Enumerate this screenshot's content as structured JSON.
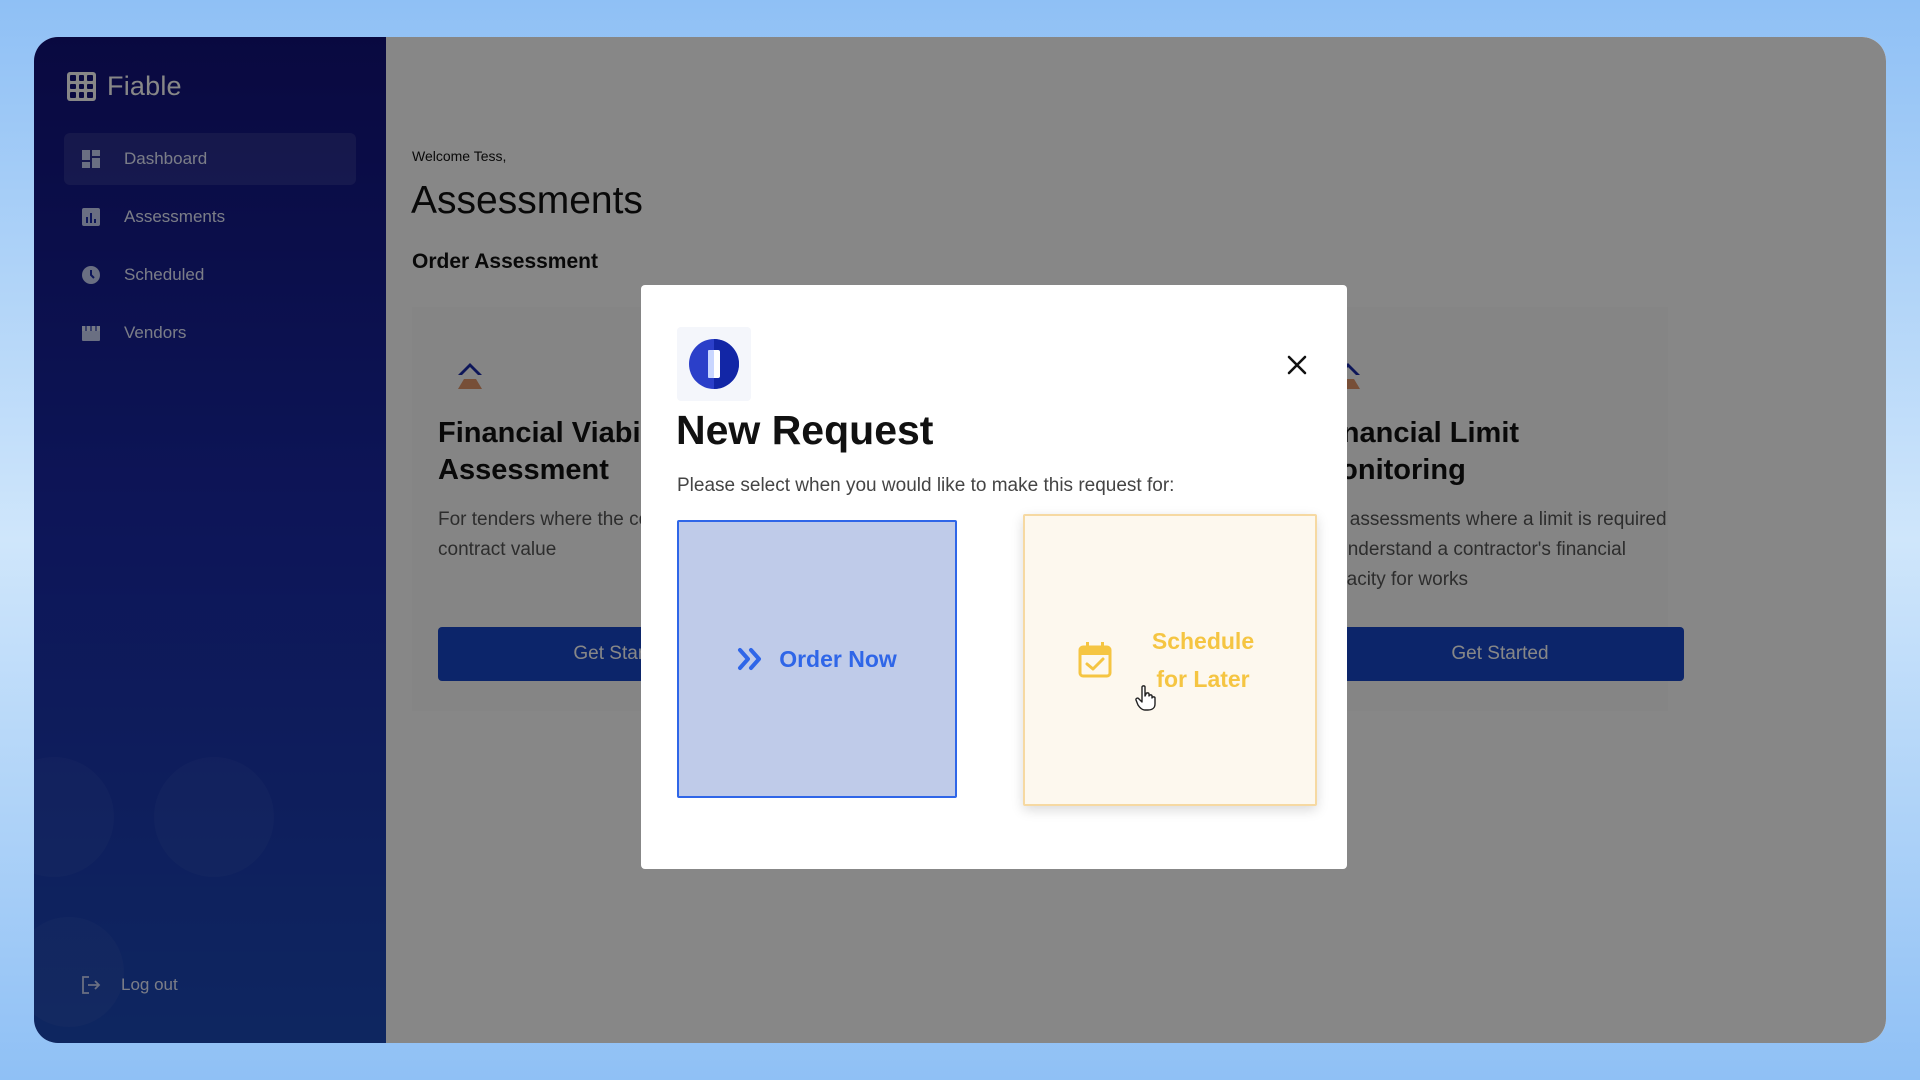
{
  "brand": {
    "name": "Fiable"
  },
  "sidebar": {
    "items": [
      {
        "label": "Dashboard",
        "icon": "dashboard-icon",
        "active": true
      },
      {
        "label": "Assessments",
        "icon": "bar-chart-icon",
        "active": false
      },
      {
        "label": "Scheduled",
        "icon": "clock-icon",
        "active": false
      },
      {
        "label": "Vendors",
        "icon": "storefront-icon",
        "active": false
      }
    ],
    "logout": {
      "label": "Log out",
      "icon": "logout-icon"
    }
  },
  "main": {
    "welcome": "Welcome Tess,",
    "title": "Assessments",
    "section_title": "Order Assessment",
    "cards": [
      {
        "title": "Financial Viability Assessment",
        "description": "For tenders where the contract is with a contract value",
        "button": "Get Started"
      },
      {
        "title": "Financial Limit Monitoring",
        "description": "For assessments where a limit is required to understand a contractor's financial capacity for works",
        "button": "Get Started"
      }
    ]
  },
  "modal": {
    "title": "New Request",
    "subtitle": "Please select when you would like to make this request for:",
    "option_now": "Order Now",
    "option_later_line1": "Schedule",
    "option_later_line2": "for Later"
  },
  "colors": {
    "sidebar_top": "#12127a",
    "sidebar_bottom": "#1c49b6",
    "primary_button": "#1846c8",
    "order_now_accent": "#2f66e8",
    "schedule_accent": "#f5c542"
  }
}
